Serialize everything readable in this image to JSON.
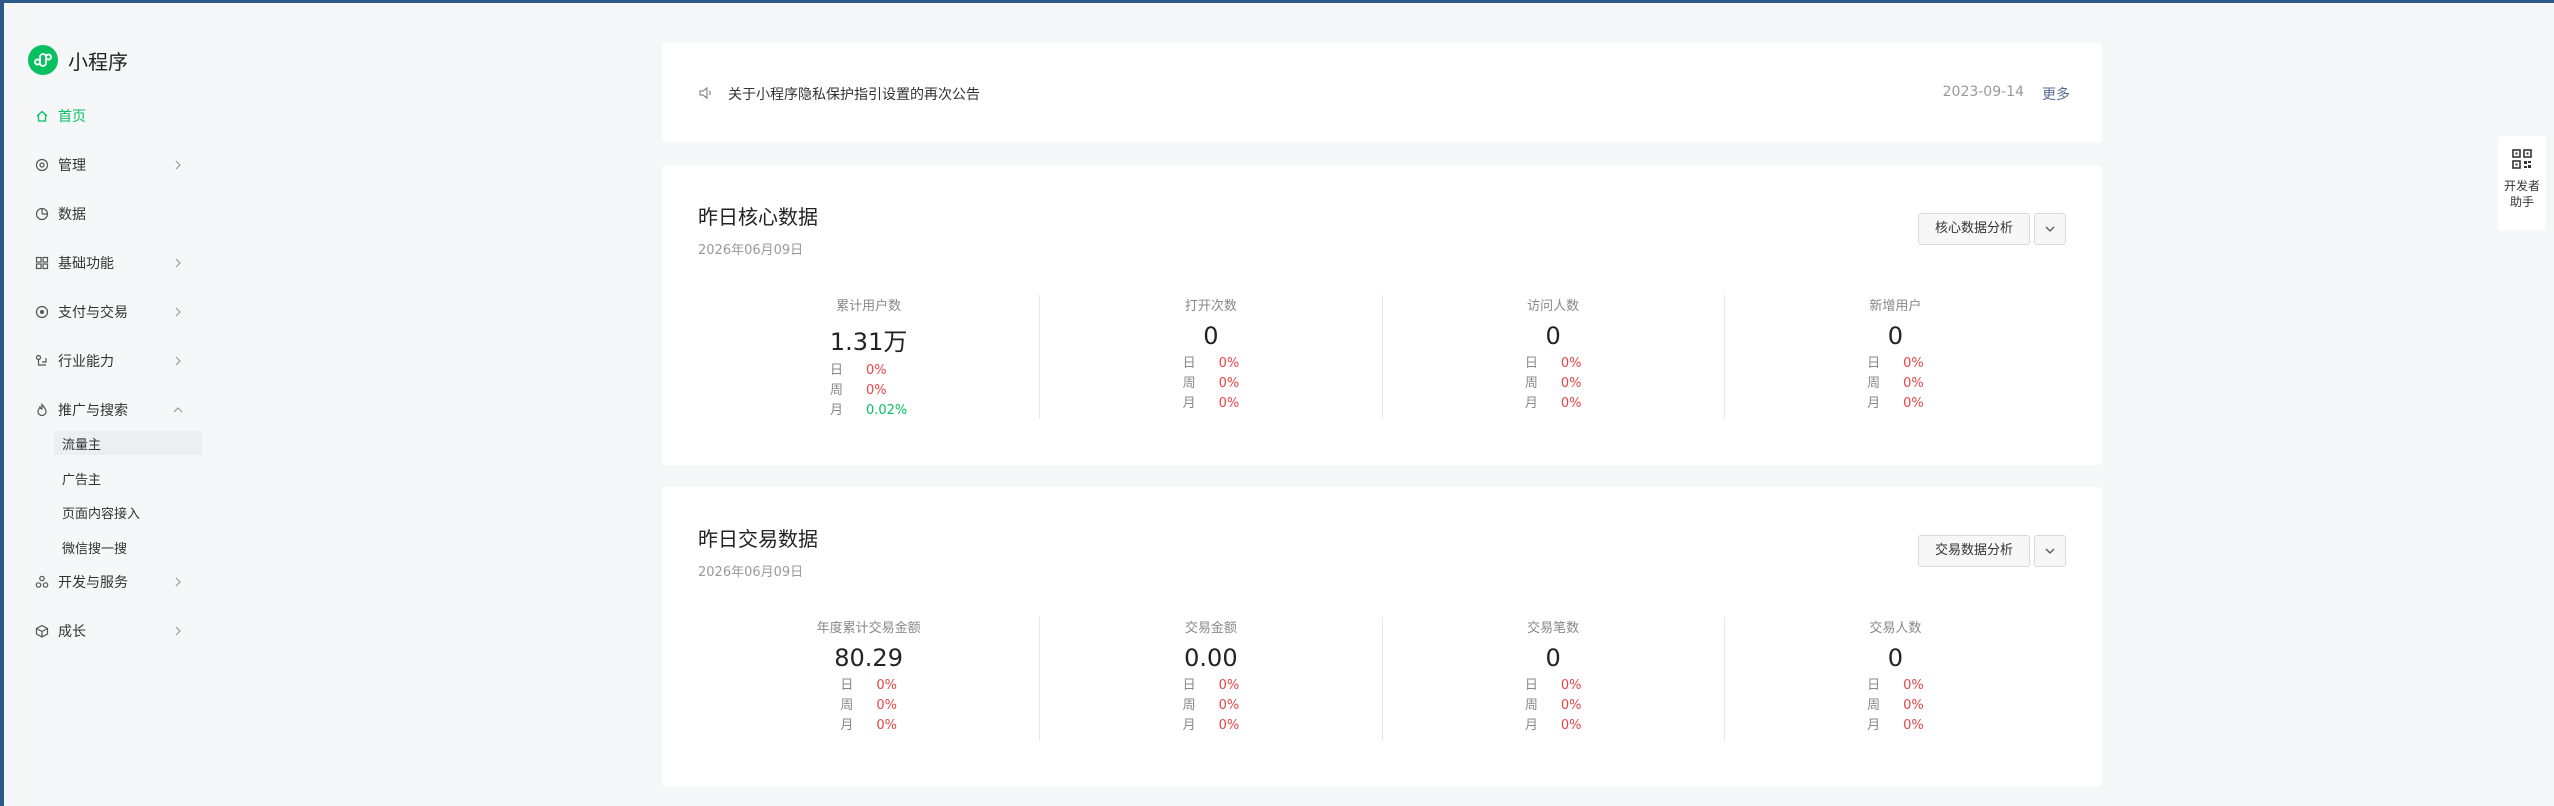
{
  "app": {
    "name": "小程序",
    "brand_color": "#07c160"
  },
  "sidebar": {
    "items": [
      {
        "label": "首页",
        "icon": "home-icon",
        "active": true
      },
      {
        "label": "管理",
        "icon": "target-icon"
      },
      {
        "label": "数据",
        "icon": "clock-pie-icon"
      },
      {
        "label": "基础功能",
        "icon": "grid-icon"
      },
      {
        "label": "支付与交易",
        "icon": "record-icon"
      },
      {
        "label": "行业能力",
        "icon": "industry-icon"
      },
      {
        "label": "推广与搜索",
        "icon": "flame-icon"
      },
      {
        "label": "开发与服务",
        "icon": "triangle-dots-icon"
      },
      {
        "label": "成长",
        "icon": "cube-icon"
      }
    ],
    "sub_items": [
      {
        "label": "流量主",
        "selected": true
      },
      {
        "label": "广告主"
      },
      {
        "label": "页面内容接入"
      },
      {
        "label": "微信搜一搜"
      }
    ]
  },
  "notice": {
    "text": "关于小程序隐私保护指引设置的再次公告",
    "date": "2023-09-14",
    "more": "更多"
  },
  "core": {
    "title": "昨日核心数据",
    "date": "2026年06月09日",
    "button": "核心数据分析",
    "metrics": [
      {
        "label": "累计用户数",
        "value": "1.31万",
        "day": "0%",
        "week": "0%",
        "month": "0.02%"
      },
      {
        "label": "打开次数",
        "value": "0",
        "day": "0%",
        "week": "0%",
        "month": "0%"
      },
      {
        "label": "访问人数",
        "value": "0",
        "day": "0%",
        "week": "0%",
        "month": "0%"
      },
      {
        "label": "新增用户",
        "value": "0",
        "day": "0%",
        "week": "0%",
        "month": "0%"
      }
    ]
  },
  "trade": {
    "title": "昨日交易数据",
    "date": "2026年06月09日",
    "button": "交易数据分析",
    "metrics": [
      {
        "label": "年度累计交易金额",
        "value": "80.29",
        "day": "0%",
        "week": "0%",
        "month": "0%"
      },
      {
        "label": "交易金额",
        "value": "0.00",
        "day": "0%",
        "week": "0%",
        "month": "0%"
      },
      {
        "label": "交易笔数",
        "value": "0",
        "day": "0%",
        "week": "0%",
        "month": "0%"
      },
      {
        "label": "交易人数",
        "value": "0",
        "day": "0%",
        "week": "0%",
        "month": "0%"
      }
    ]
  },
  "period_labels": {
    "day": "日",
    "week": "周",
    "month": "月"
  },
  "helper": {
    "line1": "开发者",
    "line2": "助手"
  },
  "colors": {
    "increase": "#07c160",
    "decrease": "#e54545",
    "link": "#576b95"
  }
}
